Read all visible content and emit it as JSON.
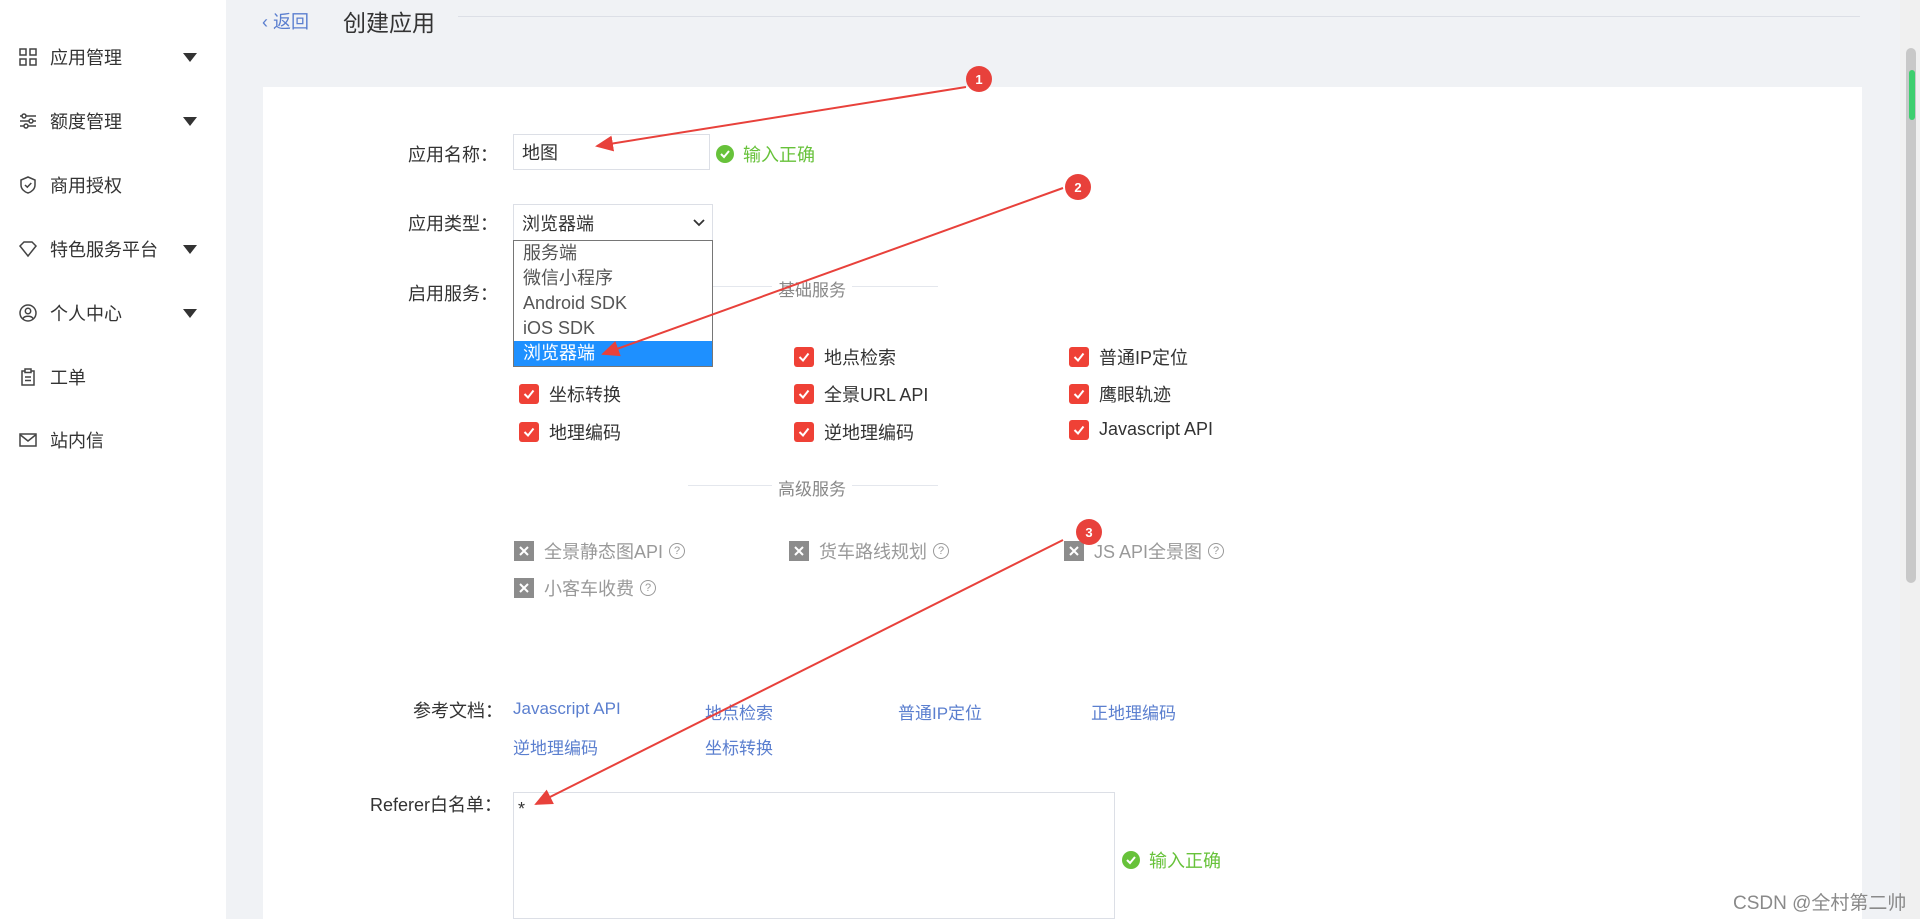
{
  "sidebar": {
    "items": [
      {
        "label": "应用管理",
        "icon": "grid-icon",
        "has_caret": true
      },
      {
        "label": "额度管理",
        "icon": "sliders-icon",
        "has_caret": true
      },
      {
        "label": "商用授权",
        "icon": "shield-check-icon",
        "has_caret": false
      },
      {
        "label": "特色服务平台",
        "icon": "diamond-icon",
        "has_caret": true
      },
      {
        "label": "个人中心",
        "icon": "user-circle-icon",
        "has_caret": true
      },
      {
        "label": "工单",
        "icon": "clipboard-icon",
        "has_caret": false
      },
      {
        "label": "站内信",
        "icon": "mail-icon",
        "has_caret": false
      }
    ]
  },
  "header": {
    "back_label": "返回",
    "title": "创建应用"
  },
  "form": {
    "name_label": "应用名称：",
    "name_value": "地图",
    "name_status": "输入正确",
    "type_label": "应用类型：",
    "type_value": "浏览器端",
    "type_options": [
      "服务端",
      "微信小程序",
      "Android SDK",
      "iOS SDK",
      "浏览器端"
    ],
    "type_selected_index": 4,
    "services_label": "启用服务：",
    "basic_section": "基础服务",
    "basic_services": [
      {
        "label": "地点检索",
        "checked": true
      },
      {
        "label": "普通IP定位",
        "checked": true
      },
      {
        "label": "坐标转换",
        "checked": true
      },
      {
        "label": "全景URL API",
        "checked": true
      },
      {
        "label": "鹰眼轨迹",
        "checked": true
      },
      {
        "label": "地理编码",
        "checked": true
      },
      {
        "label": "逆地理编码",
        "checked": true
      },
      {
        "label": "Javascript API",
        "checked": true
      }
    ],
    "advanced_section": "高级服务",
    "advanced_services": [
      {
        "label": "全景静态图API",
        "help": "?"
      },
      {
        "label": "货车路线规划",
        "help": "?"
      },
      {
        "label": "JS API全景图",
        "help": "?"
      },
      {
        "label": "小客车收费",
        "help": "?"
      }
    ],
    "docs_label": "参考文档：",
    "docs": [
      "Javascript API",
      "地点检索",
      "普通IP定位",
      "正地理编码",
      "逆地理编码",
      "坐标转换"
    ],
    "referer_label": "Referer白名单：",
    "referer_value": "*",
    "referer_status": "输入正确"
  },
  "annotations": [
    "1",
    "2",
    "3"
  ],
  "watermark": "CSDN @全村第二帅",
  "colors": {
    "accent_red": "#ef4136",
    "link_blue": "#5b7fcf",
    "success_green": "#67c23a",
    "select_blue": "#1e90ff"
  }
}
